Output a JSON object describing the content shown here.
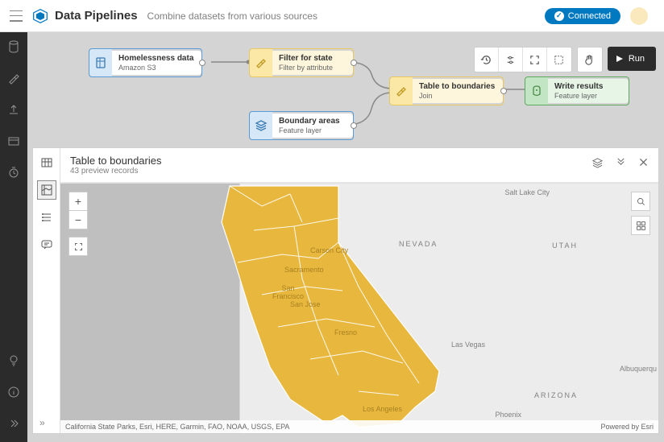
{
  "header": {
    "title": "Data Pipelines",
    "subtitle": "Combine datasets from various sources",
    "connected_label": "Connected",
    "user_name": "",
    "user_sub": ""
  },
  "toolbar": {
    "run_label": "Run"
  },
  "nodes": {
    "input": {
      "title": "Homelessness data",
      "sub": "Amazon S3"
    },
    "filter": {
      "title": "Filter for state",
      "sub": "Filter by attribute"
    },
    "boundary": {
      "title": "Boundary areas",
      "sub": "Feature layer"
    },
    "join": {
      "title": "Table to boundaries",
      "sub": "Join"
    },
    "output": {
      "title": "Write results",
      "sub": "Feature layer"
    }
  },
  "preview": {
    "title": "Table to boundaries",
    "sub": "43 preview records",
    "attribution_left": "California State Parks, Esri, HERE, Garmin, FAO, NOAA, USGS, EPA",
    "attribution_right": "Powered by Esri"
  },
  "map_labels": {
    "slc": "Salt Lake City",
    "nevada": "NEVADA",
    "utah": "UTAH",
    "carson": "Carson City",
    "sac": "Sacramento",
    "sf": "San Francisco",
    "sj": "San Jose",
    "fresno": "Fresno",
    "vegas": "Las Vegas",
    "abq": "Albuquerqu",
    "az": "ARIZONA",
    "la": "Los Angeles",
    "phx": "Phoenix"
  }
}
